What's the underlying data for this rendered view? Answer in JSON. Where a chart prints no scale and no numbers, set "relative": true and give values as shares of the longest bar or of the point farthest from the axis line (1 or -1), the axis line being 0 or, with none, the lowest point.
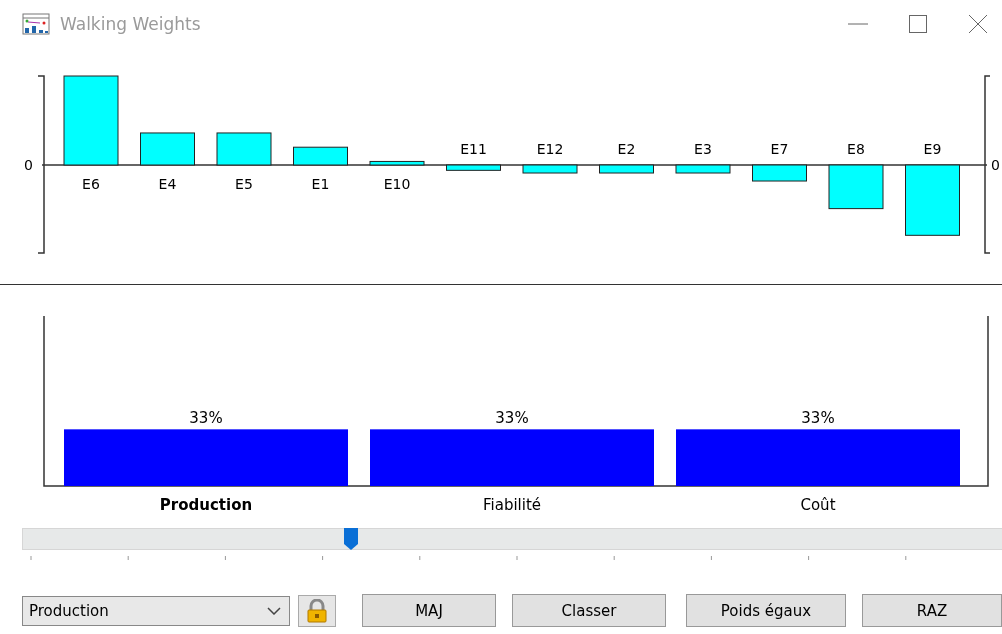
{
  "window": {
    "title": "Walking Weights"
  },
  "scores_chart": {
    "chart_data": {
      "type": "bar",
      "categories": [
        "E6",
        "E4",
        "E5",
        "E1",
        "E10",
        "E11",
        "E12",
        "E2",
        "E3",
        "E7",
        "E8",
        "E9"
      ],
      "values": [
        1.0,
        0.36,
        0.36,
        0.2,
        0.04,
        -0.06,
        -0.09,
        -0.09,
        -0.09,
        -0.18,
        -0.49,
        -0.79
      ],
      "relative": true,
      "annotations": [
        "0",
        "0"
      ]
    }
  },
  "weights_chart": {
    "chart_data": {
      "type": "bar",
      "categories": [
        "Production",
        "Fiabilité",
        "Coût"
      ],
      "values": [
        33,
        33,
        33
      ],
      "value_labels": [
        "33%",
        "33%",
        "33%"
      ]
    },
    "criteria": [
      {
        "selected": true
      },
      {
        "selected": false
      },
      {
        "selected": false
      }
    ]
  },
  "slider": {
    "level": 0.335
  },
  "criterion_select": {
    "value": "Production"
  },
  "lock": {
    "locked": true
  },
  "buttons": [
    "MAJ",
    "Classer",
    "Poids égaux",
    "RAZ"
  ]
}
